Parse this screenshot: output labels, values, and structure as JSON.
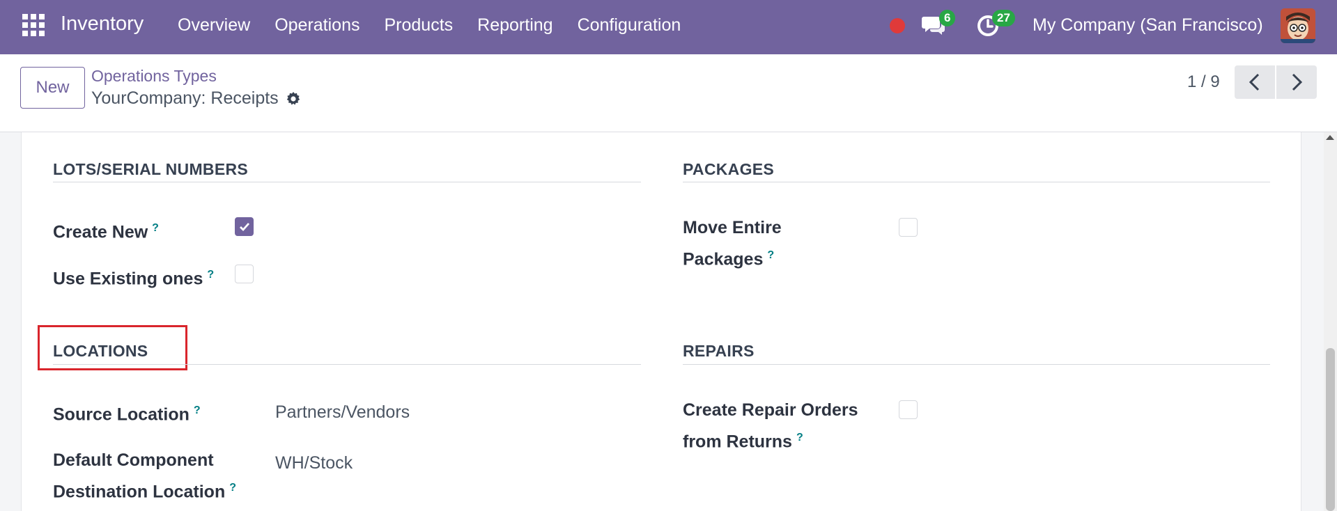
{
  "navbar": {
    "app_name": "Inventory",
    "menu": [
      "Overview",
      "Operations",
      "Products",
      "Reporting",
      "Configuration"
    ],
    "messages_count": "6",
    "activities_count": "27",
    "company": "My Company (San Francisco)",
    "icons": [
      "apps-grid-icon",
      "record-dot-icon",
      "chat-icon",
      "activity-clock-icon",
      "user-avatar"
    ],
    "colors": {
      "bar": "#71639e",
      "badge": "#28a745",
      "rec": "#e03a3a"
    }
  },
  "control": {
    "new_label": "New",
    "breadcrumb_parent": "Operations Types",
    "breadcrumb_current": "YourCompany: Receipts",
    "pager": "1 / 9"
  },
  "form": {
    "lots": {
      "title": "LOTS/SERIAL NUMBERS",
      "create_new_label": "Create New",
      "create_new_checked": true,
      "use_existing_label": "Use Existing ones",
      "use_existing_checked": false
    },
    "packages": {
      "title": "PACKAGES",
      "move_entire_line1": "Move Entire",
      "move_entire_line2": "Packages",
      "move_entire_checked": false
    },
    "locations": {
      "title": "LOCATIONS",
      "source_label": "Source Location",
      "source_value": "Partners/Vendors",
      "dest_line1": "Default Component",
      "dest_line2": "Destination Location",
      "dest_value": "WH/Stock"
    },
    "repairs": {
      "title": "REPAIRS",
      "create_repair_line1": "Create Repair Orders",
      "create_repair_line2": "from Returns",
      "create_repair_checked": false
    },
    "help_mark": "?"
  }
}
